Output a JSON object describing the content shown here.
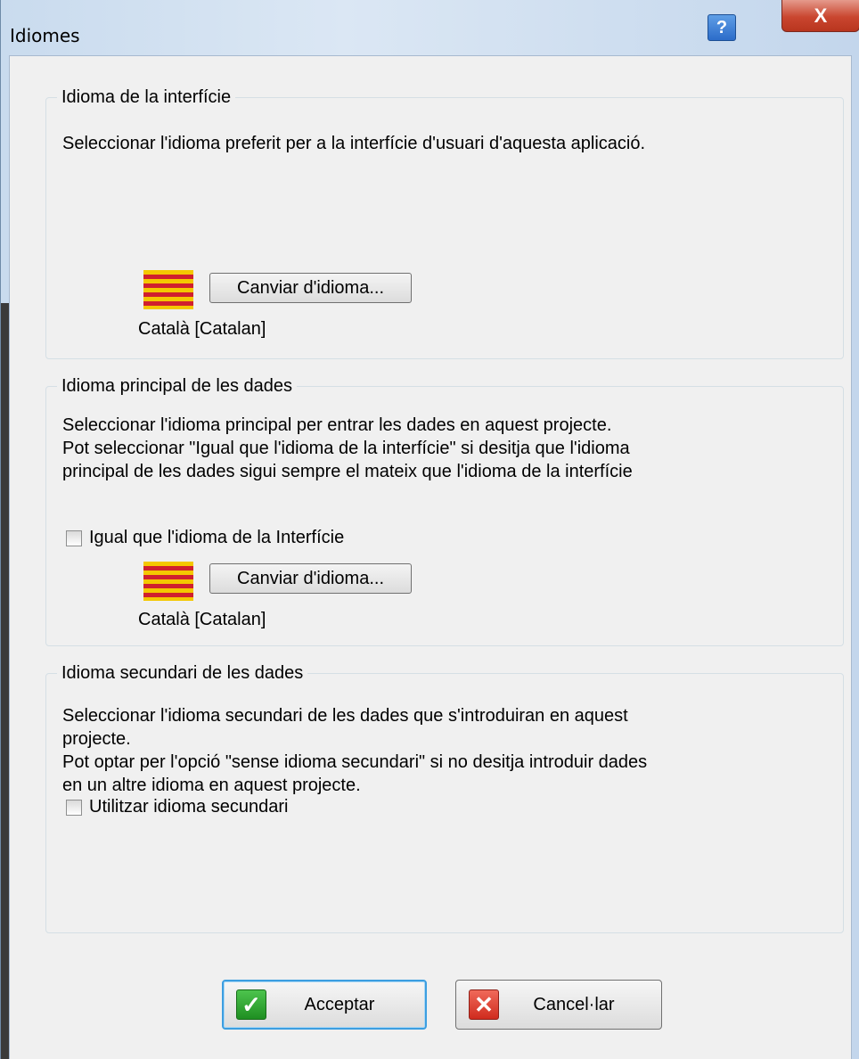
{
  "window": {
    "title": "Idiomes",
    "help_label": "?",
    "close_label": "X"
  },
  "interface_group": {
    "legend": "Idioma de la interfície",
    "description": "Seleccionar l'idioma preferit per a la interfície d'usuari d'aquesta aplicació.",
    "flag_icon": "catalan-flag-icon",
    "change_button": "Canviar d'idioma...",
    "language_name": "Català [Catalan]"
  },
  "primary_group": {
    "legend": "Idioma principal de les dades",
    "description_lines": [
      "Seleccionar l'idioma principal per entrar les dades en aquest projecte.",
      "Pot seleccionar \"Igual que l'idioma de la interfície\" si desitja que l'idioma",
      "principal de les dades sigui sempre el mateix que l'idioma de la interfície"
    ],
    "same_as_interface_label": "Igual que l'idioma de la Interfície",
    "same_as_interface_checked": false,
    "flag_icon": "catalan-flag-icon",
    "change_button": "Canviar d'idioma...",
    "language_name": "Català [Catalan]"
  },
  "secondary_group": {
    "legend": "Idioma secundari de les dades",
    "description_lines": [
      "Seleccionar l'idioma secundari de les dades que s'introduiran en aquest",
      "projecte.",
      "Pot optar per l'opció \"sense idioma secundari\" si no desitja introduir dades",
      "en un altre idioma en aquest projecte."
    ],
    "use_secondary_label": "Utilitzar idioma secundari",
    "use_secondary_checked": false
  },
  "footer": {
    "accept_label": "Acceptar",
    "accept_icon": "green-check-icon",
    "cancel_label": "Cancel·lar",
    "cancel_icon": "red-x-icon"
  },
  "colors": {
    "flag_yellow": "#f4c800",
    "flag_red": "#d0202e",
    "focus_border": "#3c9ee0"
  }
}
